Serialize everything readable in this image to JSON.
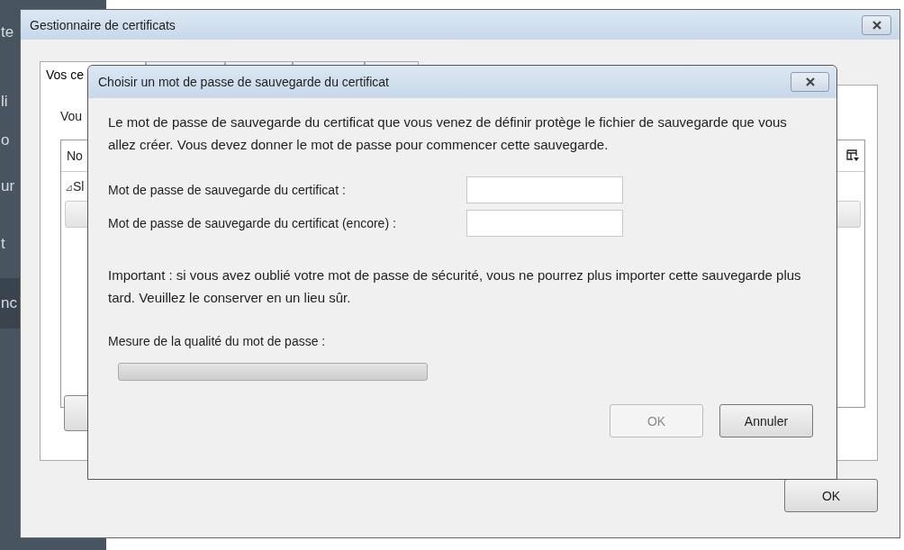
{
  "sidebar": {
    "items": [
      {
        "label": "te",
        "selected": false
      },
      {
        "label": "li",
        "selected": false
      },
      {
        "label": "o",
        "selected": false
      },
      {
        "label": "ur",
        "selected": false
      },
      {
        "label": "t",
        "selected": false
      },
      {
        "label": "nc",
        "selected": true
      }
    ]
  },
  "window": {
    "title": "Gestionnaire de certificats",
    "tabs": [
      {
        "label": "Vos ce",
        "selected": true
      },
      {
        "selected": false
      },
      {
        "selected": false
      },
      {
        "selected": false
      },
      {
        "selected": false
      }
    ],
    "panel_text": "Vou",
    "tree": {
      "column_1": "No",
      "rows": [
        {
          "expander": "⊿",
          "label": "Sl",
          "expanded": true
        }
      ]
    },
    "buttons": [
      "OK"
    ]
  },
  "dialog": {
    "title": "Choisir un mot de passe de sauvegarde du certificat",
    "intro": "Le mot de passe de sauvegarde du certificat que vous venez de définir protège le fichier de sauvegarde que vous allez créer. Vous devez donner le mot de passe pour commencer cette sauvegarde.",
    "fields": [
      {
        "label": "Mot de passe de sauvegarde du certificat :"
      },
      {
        "label": "Mot de passe de sauvegarde du certificat (encore) :"
      }
    ],
    "warning": "Important : si vous avez oublié votre mot de passe de sécurité, vous ne pourrez plus importer cette sauvegarde plus tard. Veuillez le conserver en un lieu sûr.",
    "quality": {
      "label": "Mesure de la qualité du mot de passe :",
      "level": 0
    },
    "buttons": [
      {
        "label": "OK",
        "disabled": true
      },
      {
        "label": "Annuler",
        "disabled": false
      }
    ]
  }
}
